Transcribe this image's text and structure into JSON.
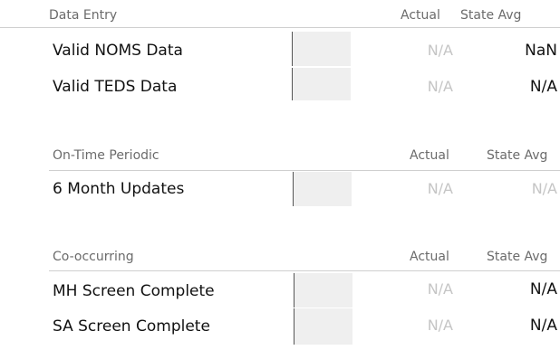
{
  "sections": [
    {
      "title": "Data Entry",
      "col_actual": "Actual",
      "col_state_avg": "State Avg",
      "rows": [
        {
          "label": "Valid NOMS Data",
          "actual": "N/A",
          "state_avg": "NaN"
        },
        {
          "label": "Valid TEDS Data",
          "actual": "N/A",
          "state_avg": "N/A"
        }
      ]
    },
    {
      "title": "On-Time Periodic",
      "col_actual": "Actual",
      "col_state_avg": "State Avg",
      "rows": [
        {
          "label": "6 Month Updates",
          "actual": "N/A",
          "state_avg": "N/A"
        }
      ]
    },
    {
      "title": "Co-occurring",
      "col_actual": "Actual",
      "col_state_avg": "State Avg",
      "rows": [
        {
          "label": "MH Screen Complete",
          "actual": "N/A",
          "state_avg": "N/A"
        },
        {
          "label": "SA Screen Complete",
          "actual": "N/A",
          "state_avg": "N/A"
        }
      ]
    }
  ]
}
